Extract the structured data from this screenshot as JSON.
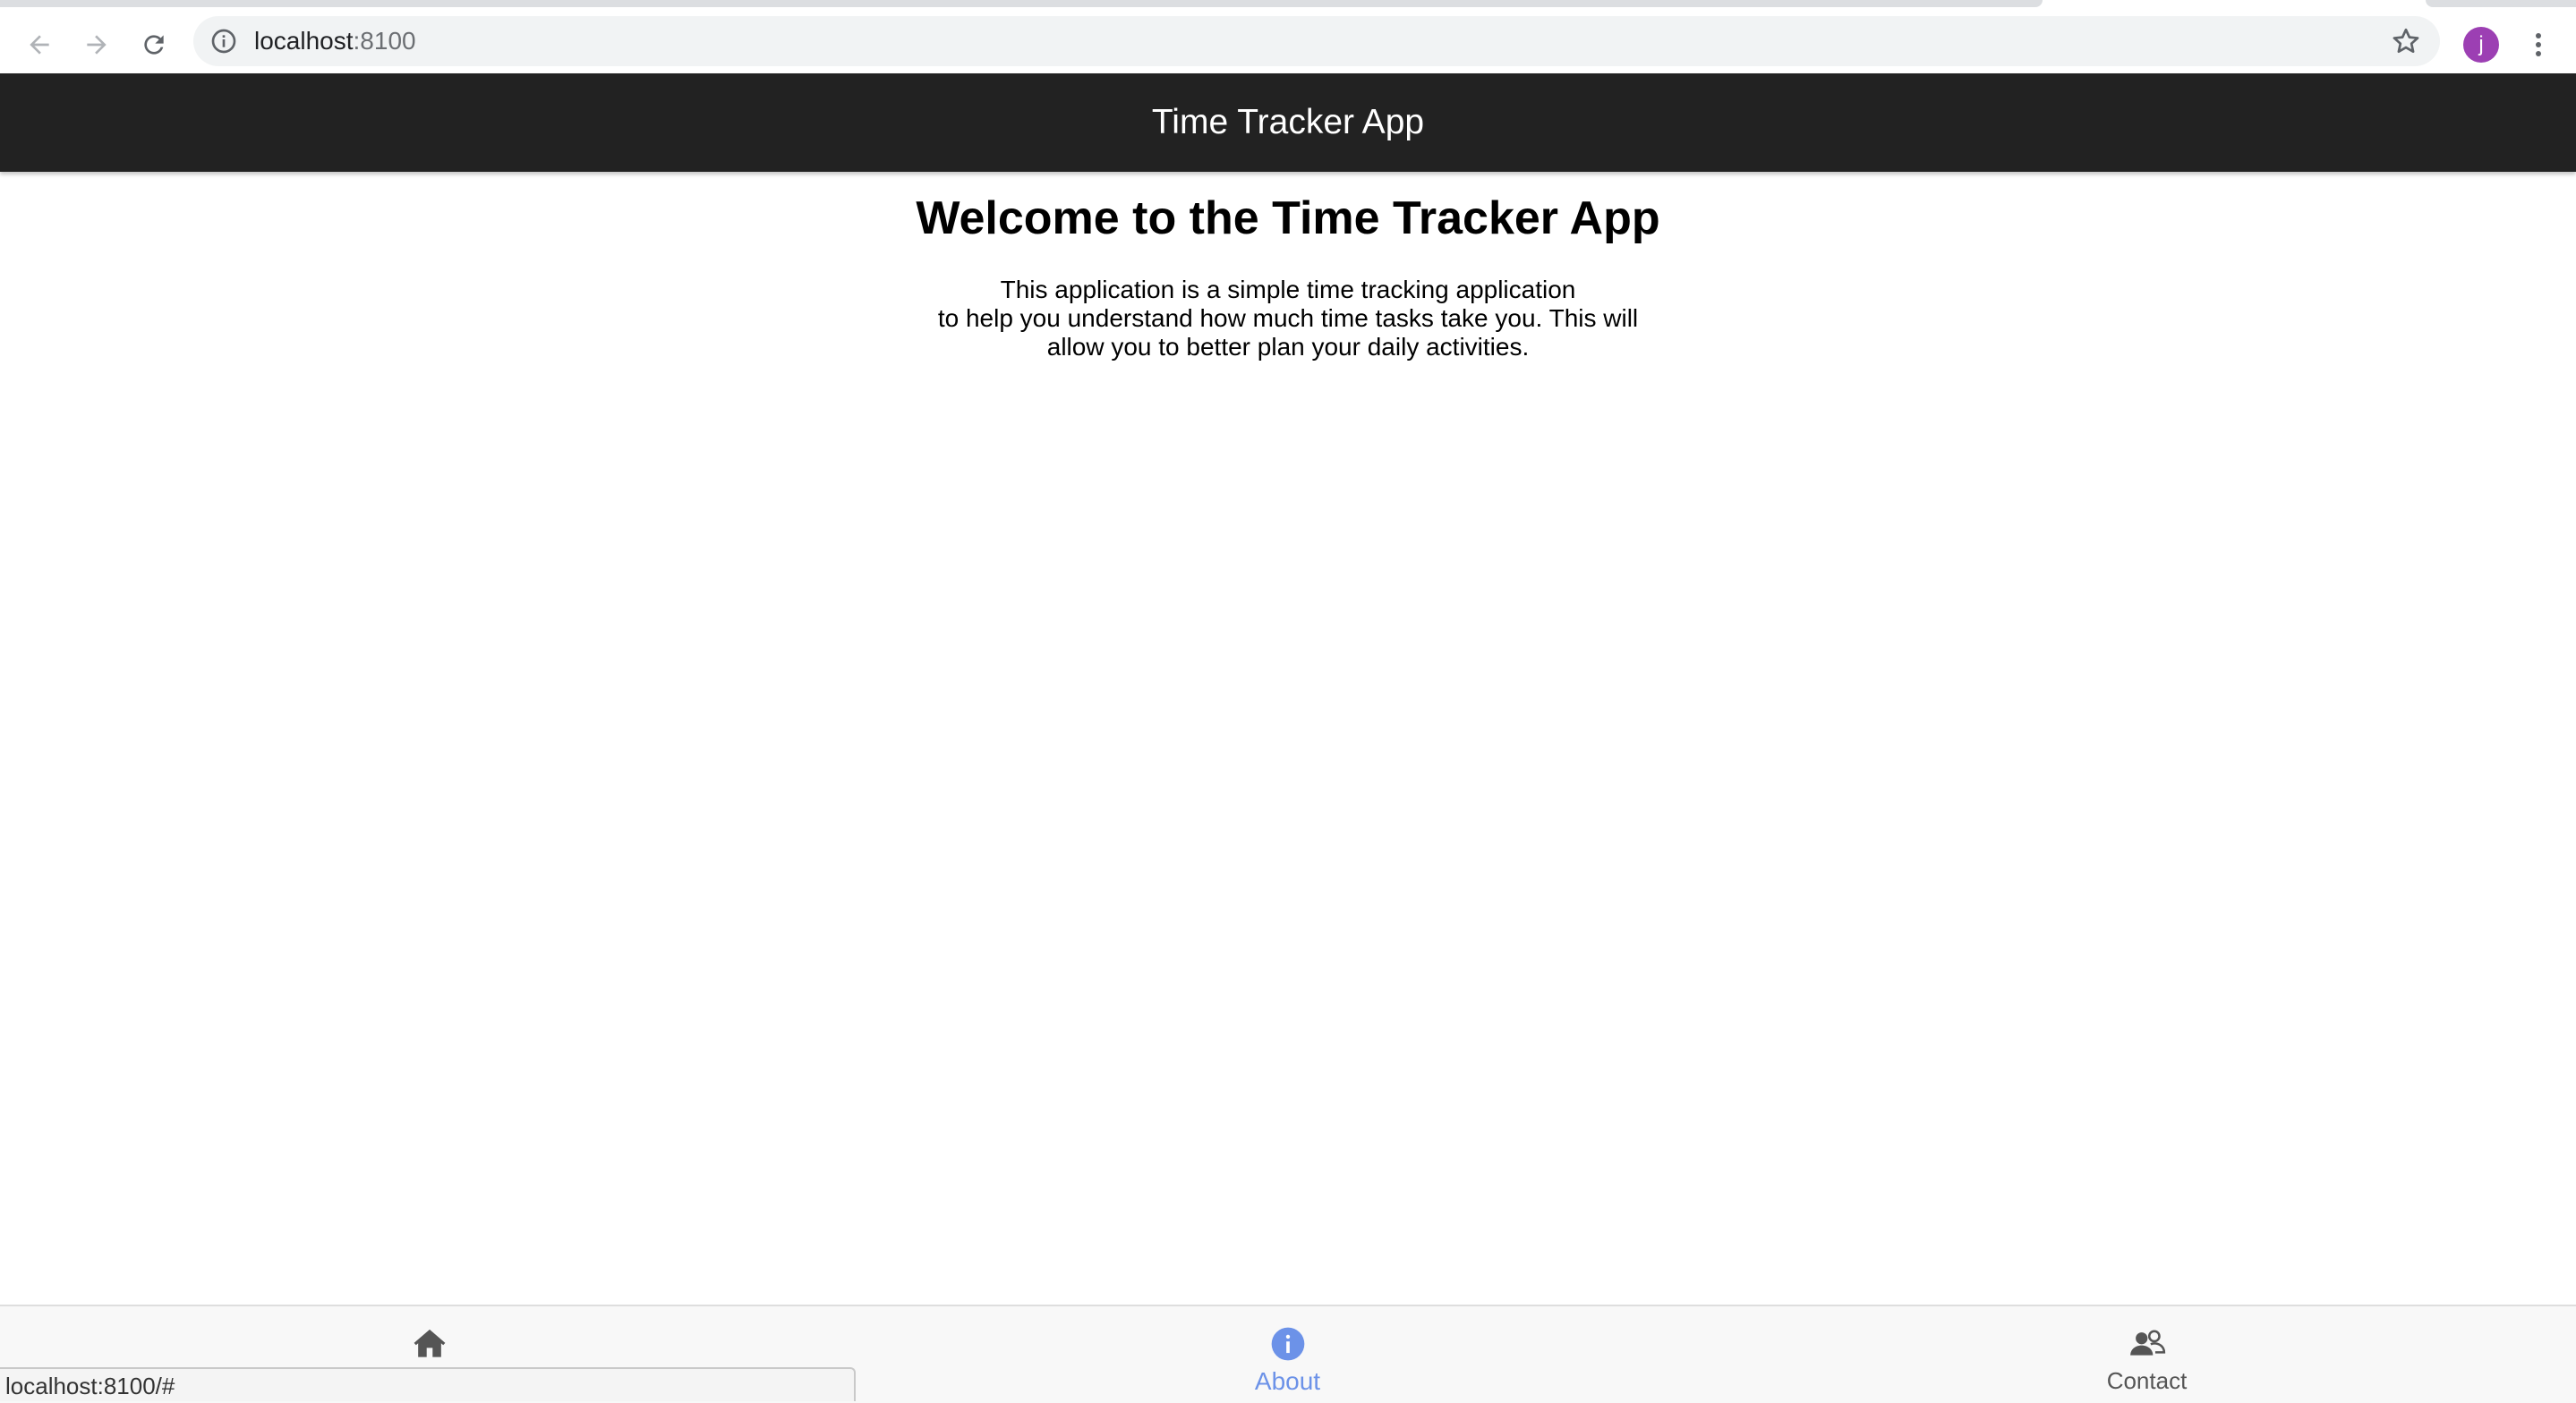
{
  "browser": {
    "url_host": "localhost",
    "url_port": ":8100",
    "profile_initial": "j",
    "status_url": "localhost:8100/#"
  },
  "app": {
    "title": "Time Tracker App"
  },
  "content": {
    "heading": "Welcome to the Time Tracker App",
    "paragraph_line1": "This application is a simple time tracking application",
    "paragraph_line2": "to help you understand how much time tasks take you. This will",
    "paragraph_line3": "allow you to better plan your daily activities."
  },
  "tabs": [
    {
      "label": "",
      "icon": "home-icon",
      "active": false
    },
    {
      "label": "About",
      "icon": "information-icon",
      "active": true
    },
    {
      "label": "Contact",
      "icon": "people-icon",
      "active": false
    }
  ],
  "colors": {
    "header_bg": "#222222",
    "active_tab": "#6c92e8",
    "avatar_bg": "#9c3fb3"
  }
}
